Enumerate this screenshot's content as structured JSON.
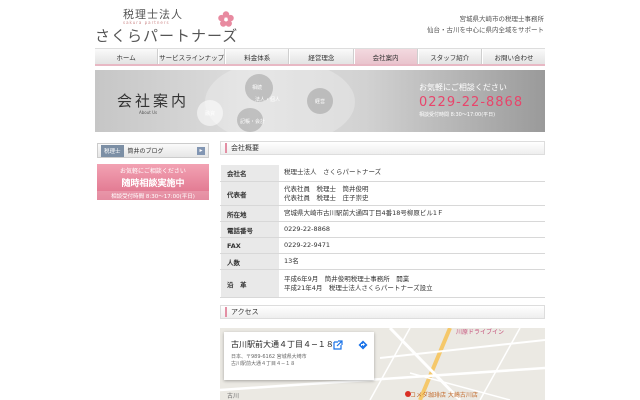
{
  "header": {
    "logo_sub": "税理士法人",
    "logo_tag": "sakura partners",
    "logo_main": "さくらパートナーズ",
    "right_line1": "宮城県大崎市の税理士事務所",
    "right_line2": "仙台・古川を中心に県内全域をサポート"
  },
  "nav": [
    {
      "label": "ホーム"
    },
    {
      "label": "サービスラインナップ"
    },
    {
      "label": "料金体系"
    },
    {
      "label": "経営理念"
    },
    {
      "label": "会社案内"
    },
    {
      "label": "スタッフ紹介"
    },
    {
      "label": "お問い合わせ"
    }
  ],
  "hero": {
    "title": "会社案内",
    "sub": "About Us",
    "deco1": "相続",
    "deco2": "経営",
    "deco3": "法人・個人",
    "deco4": "融資",
    "deco5": "記帳・会計",
    "contact_q": "お気軽にご相談ください",
    "tel": "0229-22-8868",
    "hours": "相談受付時間 8:30〜17:00(平日)"
  },
  "sidebar": {
    "blog_tag": "税理士",
    "blog_text": "筒井のブログ",
    "blog_arrow": "▸",
    "consult_a": "お気軽にご相談ください",
    "consult_b": "随時相談実施中",
    "consult_c": "相談受付時間 8:30〜17:00(平日)"
  },
  "company": {
    "heading": "会社概要",
    "rows": [
      {
        "label": "会社名",
        "value": "税理士法人　さくらパートナーズ"
      },
      {
        "label": "代表者",
        "value": "代表社員　税理士　筒井俊明",
        "value2": "代表社員　税理士　庄子崇史"
      },
      {
        "label": "所在地",
        "value": "宮城県大崎市古川駅前大通四丁目4番18号柳原ビル1Ｆ"
      },
      {
        "label": "電話番号",
        "value": "0229-22-8868"
      },
      {
        "label": "FAX",
        "value": "0229-22-9471"
      },
      {
        "label": "人数",
        "value": "13名"
      },
      {
        "label": "沿　革",
        "value": "平成6年9月　筒井俊明税理士事務所　開業",
        "value2": "平成21年4月　税理士法人さくらパートナーズ設立"
      }
    ]
  },
  "access": {
    "heading": "アクセス",
    "map_title": "古川駅前大通４丁目４−１８",
    "map_addr1": "日本、〒989-6162 宮城県大崎市",
    "map_addr2": "古川駅前大通４丁目４−１８",
    "map_label1": "川原ドライブイン",
    "map_label2": "コメダ珈琲店 大崎古川店",
    "map_label3": "古川"
  },
  "colors": {
    "accent_pink": "#e38fa4",
    "tel_pink": "#e8456b",
    "nav_active": "#f3d9df"
  }
}
